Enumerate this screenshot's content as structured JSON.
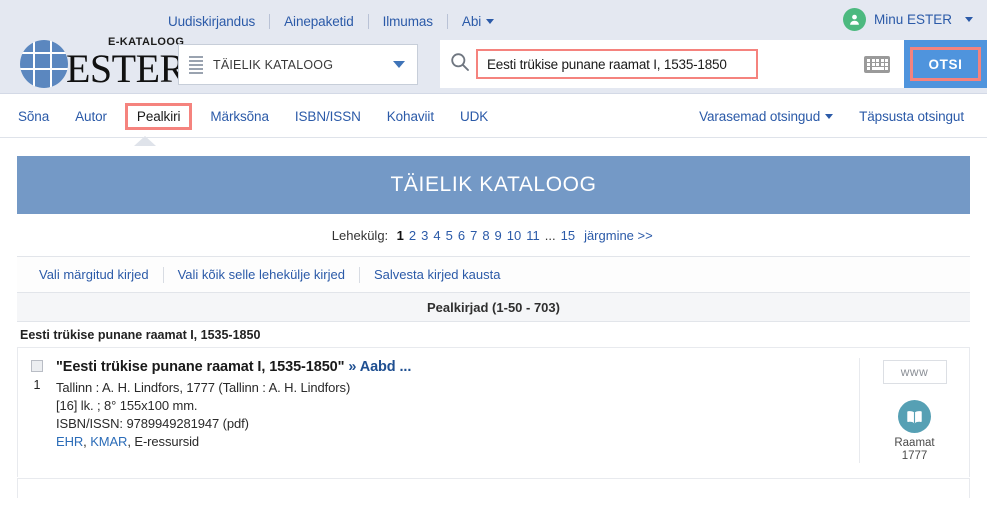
{
  "header": {
    "top_links": [
      {
        "label": "Uudiskirjandus",
        "has_caret": false
      },
      {
        "label": "Ainepaketid",
        "has_caret": false
      },
      {
        "label": "Ilmumas",
        "has_caret": false
      },
      {
        "label": "Abi",
        "has_caret": true
      }
    ],
    "user_menu": "Minu ESTER",
    "logo_top": "E-KATALOOG",
    "logo_main": "ESTER",
    "scope_selected": "TÄIELIK KATALOOG",
    "search_value": "Eesti trükise punane raamat I, 1535-1850",
    "search_placeholder": "",
    "search_button": "OTSI"
  },
  "tabs": {
    "items": [
      {
        "label": "Sõna",
        "active": false
      },
      {
        "label": "Autor",
        "active": false
      },
      {
        "label": "Pealkiri",
        "active": true
      },
      {
        "label": "Märksõna",
        "active": false
      },
      {
        "label": "ISBN/ISSN",
        "active": false
      },
      {
        "label": "Kohaviit",
        "active": false
      },
      {
        "label": "UDK",
        "active": false
      }
    ],
    "right": [
      {
        "label": "Varasemad otsingud",
        "has_caret": true
      },
      {
        "label": "Täpsusta otsingut",
        "has_caret": false
      }
    ]
  },
  "main": {
    "banner_title": "TÄIELIK KATALOOG",
    "pager": {
      "label": "Lehekülg:",
      "pages": [
        "1",
        "2",
        "3",
        "4",
        "5",
        "6",
        "7",
        "8",
        "9",
        "10",
        "11"
      ],
      "current": "1",
      "ellipsis": "...",
      "last": "15",
      "next_label": "järgmine >>"
    },
    "actions": [
      "Vali märgitud kirjed",
      "Vali kõik selle lehekülje kirjed",
      "Salvesta kirjed kausta"
    ],
    "results_header": "Pealkirjad (1-50 - 703)",
    "group_heading": "Eesti trükise punane raamat I, 1535-1850",
    "records": [
      {
        "number": "1",
        "title_main": "\"Eesti trükise punane raamat I, 1535-1850\"",
        "title_sub": "» Aabd ...",
        "imprint": "Tallinn : A. H. Lindfors, 1777 (Tallinn : A. H. Lindfors)",
        "extent": "[16] lk. ; 8° 155x100 mm.",
        "isbn_label": "ISBN/ISSN:",
        "isbn_value": "9789949281947 (pdf)",
        "holdings": [
          {
            "text": "EHR",
            "link": true
          },
          {
            "text": ", ",
            "link": false
          },
          {
            "text": "KMAR",
            "link": true
          },
          {
            "text": ", E-ressursid",
            "link": false
          }
        ],
        "www_label": "www",
        "media_type": "Raamat",
        "media_year": "1777"
      }
    ]
  },
  "colors": {
    "header_bg": "#e4e8f1",
    "link_blue": "#2b5aa8",
    "banner_blue": "#7499c6",
    "button_blue": "#4f94dd",
    "highlight_red": "#f5837e",
    "avatar_green": "#4cb97f",
    "media_teal": "#56a0b4"
  }
}
